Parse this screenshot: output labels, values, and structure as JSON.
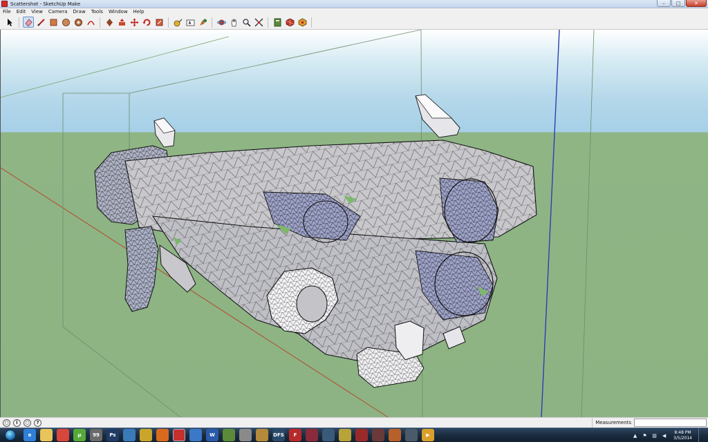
{
  "window": {
    "title": "Scattershot - SketchUp Make",
    "minimize_glyph": "–",
    "maximize_glyph": "□",
    "close_glyph": "✕"
  },
  "menubar": {
    "items": [
      "File",
      "Edit",
      "View",
      "Camera",
      "Draw",
      "Tools",
      "Window",
      "Help"
    ]
  },
  "toolbar": {
    "tools": [
      {
        "name": "select-tool-icon",
        "active": false
      },
      {
        "name": "eraser-tool-icon",
        "active": true
      },
      {
        "name": "pencil-line-tool-icon",
        "active": false
      },
      {
        "name": "rectangle-tool-icon",
        "active": false
      },
      {
        "name": "circle-tool-icon",
        "active": false
      },
      {
        "name": "polygon-tool-icon",
        "active": false
      },
      {
        "name": "arc-tool-icon",
        "active": false
      },
      {
        "name": "paint-bucket-tool-icon",
        "active": false
      },
      {
        "name": "push-pull-tool-icon",
        "active": false
      },
      {
        "name": "move-tool-icon",
        "active": false
      },
      {
        "name": "rotate-tool-icon",
        "active": false
      },
      {
        "name": "scale-tool-icon",
        "active": false
      },
      {
        "name": "tape-measure-tool-icon",
        "active": false
      },
      {
        "name": "text-tool-icon",
        "active": false
      },
      {
        "name": "paint-tool-icon",
        "active": false
      },
      {
        "name": "orbit-tool-icon",
        "active": false
      },
      {
        "name": "pan-tool-icon",
        "active": false
      },
      {
        "name": "zoom-tool-icon",
        "active": false
      },
      {
        "name": "zoom-extents-tool-icon",
        "active": false
      },
      {
        "name": "warehouse-tool-icon",
        "active": false
      },
      {
        "name": "share-model-tool-icon",
        "active": false
      },
      {
        "name": "extension-warehouse-tool-icon",
        "active": false
      }
    ]
  },
  "colors": {
    "sky_top": "#ffffff",
    "sky_bottom": "#a6d0e8",
    "ground": "#8db384",
    "model_face": "#c8c8cc",
    "model_back_face": "#9da2c8",
    "red_axis": "#b34a2e",
    "blue_axis": "#2a3fb0",
    "green_axis": "#3a8a3a"
  },
  "statusbar": {
    "icons": [
      {
        "name": "geo-location-icon",
        "glyph": "○"
      },
      {
        "name": "credits-icon",
        "glyph": "i"
      },
      {
        "name": "user-icon",
        "glyph": "○"
      },
      {
        "name": "help-icon",
        "glyph": "?"
      }
    ],
    "measurements_label": "Measurements",
    "measurements_value": ""
  },
  "taskbar": {
    "apps": [
      {
        "name": "internet-explorer-icon",
        "label": "e",
        "color": "#2f7fd6",
        "active": false
      },
      {
        "name": "file-explorer-icon",
        "label": "",
        "color": "#e8c45a",
        "active": false
      },
      {
        "name": "chrome-icon",
        "label": "",
        "color": "#d9463b",
        "active": false
      },
      {
        "name": "utorrent-icon",
        "label": "µ",
        "color": "#56a83a",
        "active": false
      },
      {
        "name": "app-99-icon",
        "label": "99",
        "color": "#6a6a6a",
        "active": false
      },
      {
        "name": "photoshop-icon",
        "label": "Ps",
        "color": "#1f3b66",
        "active": false
      },
      {
        "name": "media-player-icon",
        "label": "",
        "color": "#3a7ab8",
        "active": false
      },
      {
        "name": "app-yellow-icon",
        "label": "",
        "color": "#c9a52a",
        "active": false
      },
      {
        "name": "app-orange-icon",
        "label": "",
        "color": "#d86a1e",
        "active": false
      },
      {
        "name": "sketchup-icon",
        "label": "",
        "color": "#c8302b",
        "active": true
      },
      {
        "name": "app-blue-bird-icon",
        "label": "",
        "color": "#3b78c8",
        "active": false
      },
      {
        "name": "word-icon",
        "label": "W",
        "color": "#2a5aa8",
        "active": false
      },
      {
        "name": "minecraft-icon",
        "label": "",
        "color": "#5a8a3a",
        "active": false
      },
      {
        "name": "skyrim-icon",
        "label": "",
        "color": "#8a8a8a",
        "active": false
      },
      {
        "name": "app-star-icon",
        "label": "",
        "color": "#b58a3a",
        "active": false
      },
      {
        "name": "app-dfs-icon",
        "label": "DFS",
        "color": "#2a4a6a",
        "active": false
      },
      {
        "name": "app-f-icon",
        "label": "F",
        "color": "#b82a2a",
        "active": false
      },
      {
        "name": "app-car-icon",
        "label": "",
        "color": "#8a2a3a",
        "active": false
      },
      {
        "name": "app-game-icon",
        "label": "",
        "color": "#3a5a7a",
        "active": false
      },
      {
        "name": "app-spiral-icon",
        "label": "",
        "color": "#b8a23a",
        "active": false
      },
      {
        "name": "app-red-icon",
        "label": "",
        "color": "#9a2a2a",
        "active": false
      },
      {
        "name": "app-shield-icon",
        "label": "",
        "color": "#6a3a3a",
        "active": false
      },
      {
        "name": "app-circle-icon",
        "label": "",
        "color": "#b8602a",
        "active": false
      },
      {
        "name": "app-figure-icon",
        "label": "",
        "color": "#4a5a6a",
        "active": false
      },
      {
        "name": "media-play-icon",
        "label": "▶",
        "color": "#d8a02a",
        "active": false
      }
    ],
    "tray": [
      {
        "name": "tray-arrow-icon",
        "glyph": "▲"
      },
      {
        "name": "tray-flag-icon",
        "glyph": "⚑"
      },
      {
        "name": "tray-network-icon",
        "glyph": "▥"
      },
      {
        "name": "tray-volume-icon",
        "glyph": "◀"
      }
    ],
    "clock_time": "8:48 PM",
    "clock_date": "3/5/2014"
  }
}
